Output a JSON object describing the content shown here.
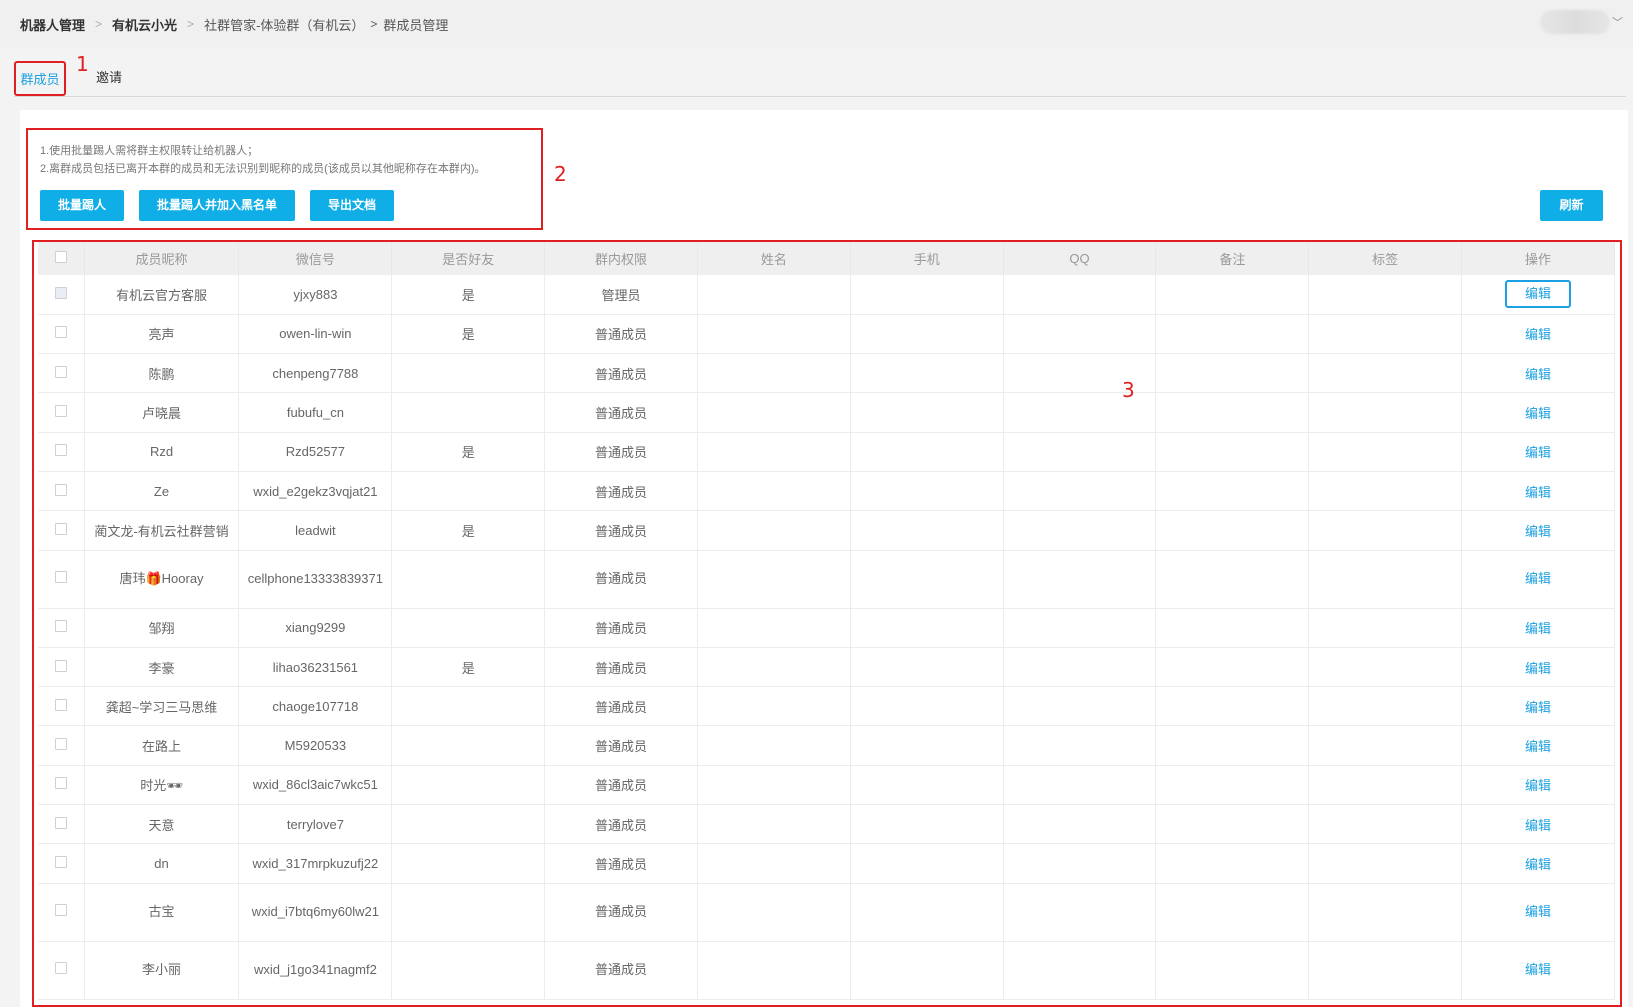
{
  "breadcrumb": {
    "items": [
      "机器人管理",
      "有机云小光",
      "社群管家-体验群（有机云）",
      "群成员管理"
    ],
    "sep1": ">",
    "sep2": ">",
    "sep3": ">"
  },
  "header": {
    "user_caret": "﹀"
  },
  "tabs": [
    {
      "label": "群成员",
      "active": true
    },
    {
      "label": "邀请",
      "active": false
    }
  ],
  "annotations": [
    "1",
    "2",
    "3"
  ],
  "notice": {
    "line1": "1.使用批量踢人需将群主权限转让给机器人；",
    "line2": "2.离群成员包括已离开本群的成员和无法识别到昵称的成员(该成员以其他昵称存在本群内)。"
  },
  "toolbar": {
    "batch_kick": "批量踢人",
    "batch_kick_blacklist": "批量踢人并加入黑名单",
    "export_doc": "导出文档",
    "refresh": "刷新"
  },
  "table": {
    "headers": [
      "成员昵称",
      "微信号",
      "是否好友",
      "群内权限",
      "姓名",
      "手机",
      "QQ",
      "备注",
      "标签",
      "操作"
    ],
    "edit_label": "编辑",
    "rows": [
      {
        "nickname": "有机云官方客服",
        "wechat": "yjxy883",
        "friend": "是",
        "role": "管理员"
      },
      {
        "nickname": "亮声",
        "wechat": "owen-lin-win",
        "friend": "是",
        "role": "普通成员"
      },
      {
        "nickname": "陈鹏",
        "wechat": "chenpeng7788",
        "friend": "",
        "role": "普通成员"
      },
      {
        "nickname": "卢晓晨",
        "wechat": "fubufu_cn",
        "friend": "",
        "role": "普通成员"
      },
      {
        "nickname": "Rzd",
        "wechat": "Rzd52577",
        "friend": "是",
        "role": "普通成员"
      },
      {
        "nickname": "Ze",
        "wechat": "wxid_e2gekz3vqjat21",
        "friend": "",
        "role": "普通成员"
      },
      {
        "nickname": "蔺文龙-有机云社群营销",
        "wechat": "leadwit",
        "friend": "是",
        "role": "普通成员"
      },
      {
        "nickname": "唐玮🎁Hooray",
        "wechat": "cellphone13333839371",
        "friend": "",
        "role": "普通成员",
        "tall": true
      },
      {
        "nickname": "邹翔",
        "wechat": "xiang9299",
        "friend": "",
        "role": "普通成员"
      },
      {
        "nickname": "李豪",
        "wechat": "lihao36231561",
        "friend": "是",
        "role": "普通成员"
      },
      {
        "nickname": "龚超~学习三马思维",
        "wechat": "chaoge107718",
        "friend": "",
        "role": "普通成员"
      },
      {
        "nickname": "在路上",
        "wechat": "M5920533",
        "friend": "",
        "role": "普通成员"
      },
      {
        "nickname": "时光🕶",
        "wechat": "wxid_86cl3aic7wkc51",
        "friend": "",
        "role": "普通成员"
      },
      {
        "nickname": "天意",
        "wechat": "terrylove7",
        "friend": "",
        "role": "普通成员"
      },
      {
        "nickname": "dn",
        "wechat": "wxid_317mrpkuzufj22",
        "friend": "",
        "role": "普通成员"
      },
      {
        "nickname": "古宝",
        "wechat": "wxid_i7btq6my60lw21",
        "friend": "",
        "role": "普通成员",
        "tall": true
      },
      {
        "nickname": "李小丽",
        "wechat": "wxid_j1go341nagmf2",
        "friend": "",
        "role": "普通成员",
        "tall": true
      }
    ]
  },
  "colors": {
    "accent": "#1ba0e1",
    "button": "#10aee7",
    "annotation": "#e02020"
  }
}
